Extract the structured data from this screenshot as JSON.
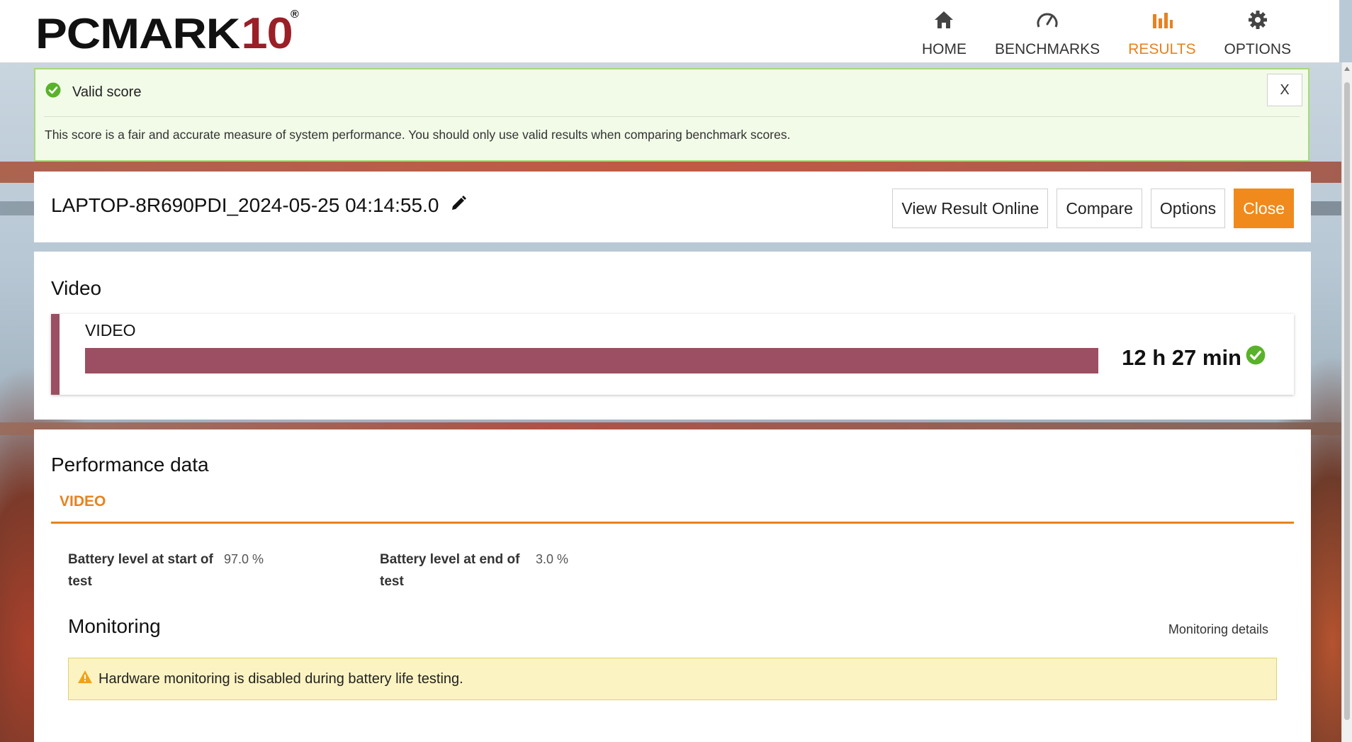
{
  "brand": {
    "logo_main": "PCMARK",
    "logo_number": "10",
    "registered_mark": "®"
  },
  "nav": {
    "items": [
      {
        "label": "HOME",
        "icon": "home-icon"
      },
      {
        "label": "BENCHMARKS",
        "icon": "gauge-icon"
      },
      {
        "label": "RESULTS",
        "icon": "bar-chart-icon",
        "active": true
      },
      {
        "label": "OPTIONS",
        "icon": "gear-icon"
      }
    ]
  },
  "valid_banner": {
    "title": "Valid score",
    "message": "This score is a fair and accurate measure of system performance. You should only use valid results when comparing benchmark scores.",
    "close_label": "X"
  },
  "result": {
    "name": "LAPTOP-8R690PDI_2024-05-25 04:14:55.0",
    "buttons": {
      "view_online": "View Result Online",
      "compare": "Compare",
      "options": "Options",
      "close": "Close"
    }
  },
  "video_section": {
    "heading": "Video",
    "test_label": "VIDEO",
    "score": "12 h 27 min",
    "bar_fill_fraction": 1.0
  },
  "performance": {
    "heading": "Performance data",
    "tab": "VIDEO",
    "battery_start_label": "Battery level at start of test",
    "battery_start_value": "97.0 %",
    "battery_end_label": "Battery level at end of test",
    "battery_end_value": "3.0 %"
  },
  "monitoring": {
    "heading": "Monitoring",
    "details_link": "Monitoring details",
    "warning": "Hardware monitoring is disabled during battery life testing."
  },
  "colors": {
    "accent": "#e8821e",
    "video_bar": "#9c4f62",
    "valid_bg": "#f2fbe8",
    "valid_border": "#a6d979",
    "warning_bg": "#fcf3c2",
    "success_green": "#59b22a",
    "logo_red": "#9a1f27"
  }
}
